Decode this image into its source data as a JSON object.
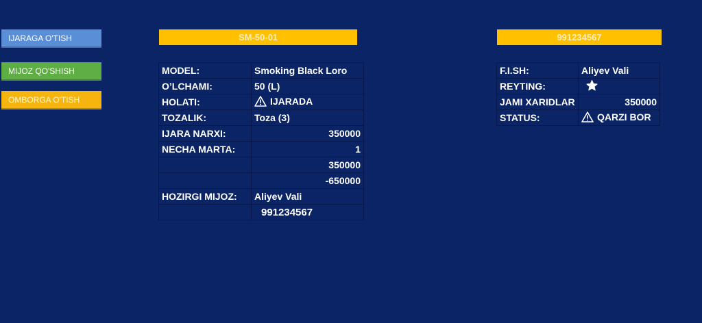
{
  "nav": {
    "rent_label": "IJARAGA O'TISH",
    "add_client_label": "MIJOZ QO'SHISH",
    "warehouse_label": "OMBORGA O'TISH"
  },
  "product": {
    "code": "SM-50-01",
    "rows": [
      {
        "label": "MODEL:",
        "value": "Smoking Black Loro"
      },
      {
        "label": "O’LCHAMI:",
        "value": "50 (L)"
      },
      {
        "label": "HOLATI:",
        "value": "IJARADA"
      },
      {
        "label": "TOZALIK:",
        "value": "Toza (3)"
      },
      {
        "label": "IJARA NARXI:",
        "value": "350000"
      },
      {
        "label": "NECHA MARTA:",
        "value": "1"
      },
      {
        "label": "",
        "value": "350000"
      },
      {
        "label": "",
        "value": "-650000"
      },
      {
        "label": "HOZIRGI MIJOZ:",
        "value": "Aliyev Vali"
      },
      {
        "label": "",
        "value": "991234567"
      }
    ]
  },
  "customer": {
    "phone": "991234567",
    "rows": [
      {
        "label": "F.I.SH:",
        "value": "Aliyev Vali"
      },
      {
        "label": "REYTING:",
        "value": ""
      },
      {
        "label": "JAMI XARIDLAR",
        "value": "350000"
      },
      {
        "label": "STATUS:",
        "value": "QARZI BOR"
      }
    ]
  },
  "icons": {
    "status_icon": "warning-icon",
    "rating_icon": "star-icon"
  },
  "colors": {
    "background": "#0b2466",
    "accent": "#ffc000"
  }
}
